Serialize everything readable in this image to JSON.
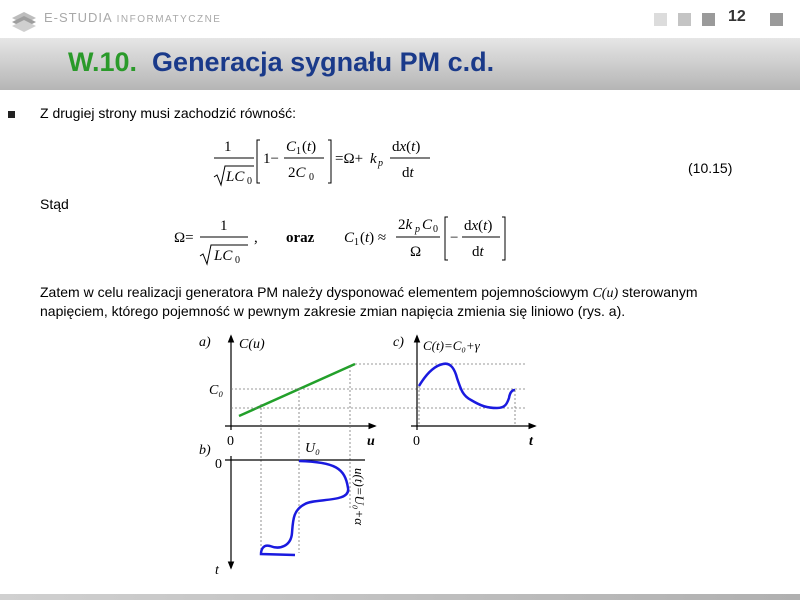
{
  "header": {
    "brand_main": "E-STUDIA",
    "brand_sub": "INFORMATYCZNE",
    "page_number": "12"
  },
  "title": {
    "number": "W.10.",
    "text": "Generacja sygnału PM c.d."
  },
  "body": {
    "line1": "Z drugiej strony musi zachodzić równość:",
    "eq_number": "(10.15)",
    "stad": "Stąd",
    "oraz": "oraz",
    "para_line1_pre": "Zatem w celu realizacji generatora PM należy dysponować elementem pojemnościowym",
    "para_line1_sym": "C(u)",
    "para_line1_post": "sterowanym",
    "para_line2": "napięciem, którego pojemność w pewnym zakresie zmian napięcia zmienia się liniowo (rys. a)."
  },
  "figure": {
    "label_a": "a)",
    "label_b": "b)",
    "label_c": "c)",
    "axis_Cu": "C(u)",
    "axis_C0": "C₀",
    "axis_u": "u",
    "zero": "0",
    "axis_U0": "U₀",
    "axis_t": "t",
    "axis_Ct_c": "C(t)=C₀+γ",
    "axis_ut": "u(t)=U₀+α",
    "axis_b_t": "t",
    "colors": {
      "line": "#22a02a",
      "curve": "#1a1adf"
    }
  }
}
